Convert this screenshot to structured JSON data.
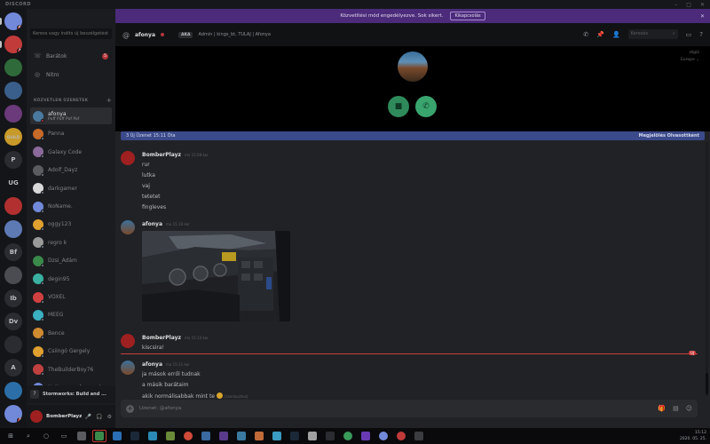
{
  "window": {
    "title": "DISCORD",
    "controls": [
      "–",
      "□",
      "✕"
    ]
  },
  "notice": {
    "text": "Közvetítési mód engedélyezve. Sok sikert.",
    "button": "Kikapcsolás",
    "close": "✕"
  },
  "servers": [
    {
      "label": "",
      "color": "#7289da",
      "badge": "6"
    },
    {
      "label": "",
      "color": "#c23b3b",
      "badge": "1"
    },
    {
      "label": "",
      "color": "#2f6b3a",
      "badge": ""
    },
    {
      "label": "",
      "color": "#3a5f8a",
      "badge": ""
    },
    {
      "label": "",
      "color": "#6b3a7a",
      "badge": ""
    },
    {
      "label": "GUILD",
      "color": "#c89a2a",
      "badge": ""
    },
    {
      "label": "P",
      "color": "#2a2c31",
      "badge": ""
    },
    {
      "label": "UG",
      "color": "#141518",
      "badge": ""
    },
    {
      "label": "",
      "color": "#b23030",
      "badge": ""
    },
    {
      "label": "",
      "color": "#5e7ab5",
      "badge": ""
    },
    {
      "label": "Bf",
      "color": "#2a2c31",
      "badge": ""
    },
    {
      "label": "",
      "color": "#4a4c52",
      "badge": ""
    },
    {
      "label": "Ib",
      "color": "#2a2c31",
      "badge": ""
    },
    {
      "label": "Dv",
      "color": "#2a2c31",
      "badge": ""
    },
    {
      "label": "",
      "color": "#2a2c31",
      "badge": ""
    },
    {
      "label": "A",
      "color": "#2a2c31",
      "badge": ""
    },
    {
      "label": "",
      "color": "#2c6fa8",
      "badge": ""
    },
    {
      "label": "",
      "color": "#7289da",
      "badge": "7"
    }
  ],
  "sidebar": {
    "search_placeholder": "Keress vagy indíts új beszélgetést",
    "friends_label": "Barátok",
    "friends_badge": "5",
    "nitro_label": "Nitro",
    "dm_header": "KÖZVETLEN ÜZENETEK",
    "dm_add": "+",
    "dms": [
      {
        "name": "afonya",
        "sub": "Puff Puff Pof Pof",
        "color": "#4a7aa0",
        "active": true
      },
      {
        "name": "Panna",
        "sub": "",
        "color": "#c76a2a",
        "active": false
      },
      {
        "name": "Galaxy Code",
        "sub": "",
        "color": "#8a6a9a",
        "active": false
      },
      {
        "name": "Adolf_Dayz",
        "sub": "",
        "color": "#5a5c60",
        "active": false
      },
      {
        "name": "darkgamer",
        "sub": "",
        "color": "#d8d8d8",
        "active": false
      },
      {
        "name": "NoName.",
        "sub": "",
        "color": "#7289da",
        "active": false
      },
      {
        "name": "oggy123",
        "sub": "",
        "color": "#e0a030",
        "active": false
      },
      {
        "name": "regro k",
        "sub": "",
        "color": "#9a9a9a",
        "active": false
      },
      {
        "name": "Dzsi_Ádám",
        "sub": "",
        "color": "#3a8a4a",
        "active": false
      },
      {
        "name": "degin95",
        "sub": "",
        "color": "#3ab0a0",
        "active": false
      },
      {
        "name": "VOXEL",
        "sub": "",
        "color": "#d04040",
        "active": false
      },
      {
        "name": "MEEG",
        "sub": "",
        "color": "#3ab0c0",
        "active": false
      },
      {
        "name": "Bence",
        "sub": "",
        "color": "#d08a30",
        "active": false
      },
      {
        "name": "Csiingó Gergely",
        "sub": "",
        "color": "#e0a030",
        "active": false
      },
      {
        "name": "TheBuilderBoy76",
        "sub": "",
        "color": "#c04040",
        "active": false
      },
      {
        "name": "NoName., afonya, dzs...",
        "sub": "",
        "color": "#7289da",
        "active": false
      }
    ],
    "now_playing": "Stormworks: Build and ..."
  },
  "user_panel": {
    "username": "BomberPlayz",
    "icons": [
      "🎤",
      "🎧",
      "⚙"
    ]
  },
  "channel": {
    "at": "@",
    "name": "afonya",
    "aka_label": "AKA",
    "nicknames": "Admin | kings_bt, TULAJ | Afonya",
    "search_placeholder": "Keresés",
    "search_icon": "⌕"
  },
  "call": {
    "region_label": "régió",
    "region_value": "Europe"
  },
  "new_messages_bar": {
    "left": "3 Új Üzenet 15:11 Óta",
    "right": "Megjelölés Olvasottként"
  },
  "messages": [
    {
      "author": "BomberPlayz",
      "time": "ma 15:08-kor",
      "avatar_color": "#9e2020",
      "lines": [
        "rur",
        "lutka",
        "vaj",
        "tetetet",
        "fingleves"
      ]
    },
    {
      "author": "afonya",
      "time": "ma 15:10-kor",
      "avatar_color": "#4a7aa0",
      "lines": []
    },
    {
      "author": "BomberPlayz",
      "time": "ma 15:10-kor",
      "avatar_color": "#9e2020",
      "lines": [
        "kiscsira!"
      ]
    },
    {
      "author": "afonya",
      "time": "ma 15:11-kor",
      "avatar_color": "#4a7aa0",
      "lines": [
        "ja mások erről tudnak",
        "a másik barátaim",
        "akik normálisabbak mint te"
      ],
      "edited": "(szerkesztve)"
    }
  ],
  "unread_tag": "ÚJ",
  "composer": {
    "placeholder": "Üzenet: @afonya"
  },
  "taskbar": {
    "time": "15:12",
    "date": "2020. 05. 25."
  }
}
